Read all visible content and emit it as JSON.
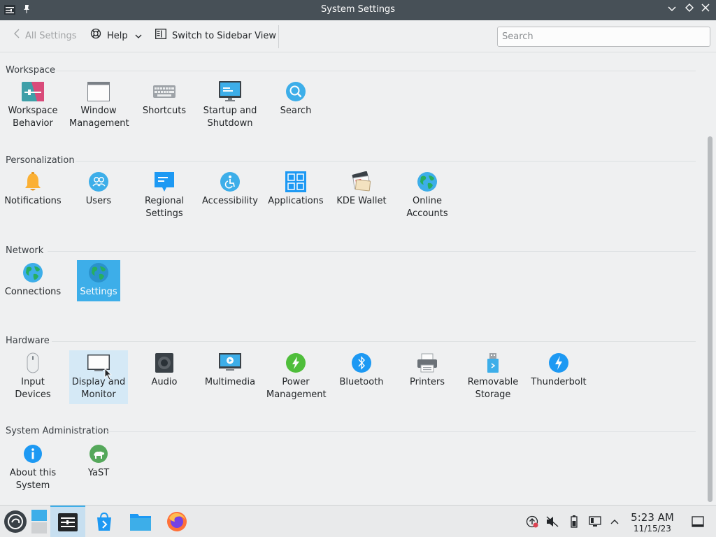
{
  "window": {
    "title": "System Settings",
    "pin_icon": "pin-icon",
    "buttons": [
      "minimize-icon",
      "maximize-icon",
      "close-icon"
    ]
  },
  "toolbar": {
    "back_label": "All Settings",
    "help_label": "Help",
    "switch_label": "Switch to Sidebar View",
    "search_placeholder": "Search"
  },
  "sections": [
    {
      "title": "Workspace",
      "items": [
        {
          "label": "Workspace Behavior",
          "icon": "workspace-behavior-icon"
        },
        {
          "label": "Window Management",
          "icon": "window-management-icon"
        },
        {
          "label": "Shortcuts",
          "icon": "keyboard-icon"
        },
        {
          "label": "Startup and Shutdown",
          "icon": "monitor-icon"
        },
        {
          "label": "Search",
          "icon": "search-icon"
        }
      ]
    },
    {
      "title": "Personalization",
      "items": [
        {
          "label": "Notifications",
          "icon": "bell-icon"
        },
        {
          "label": "Users",
          "icon": "users-icon"
        },
        {
          "label": "Regional Settings",
          "icon": "speech-bubble-icon"
        },
        {
          "label": "Accessibility",
          "icon": "accessibility-icon"
        },
        {
          "label": "Applications",
          "icon": "applications-grid-icon"
        },
        {
          "label": "KDE Wallet",
          "icon": "wallet-icon"
        },
        {
          "label": "Online Accounts",
          "icon": "globe-icon"
        }
      ]
    },
    {
      "title": "Network",
      "items": [
        {
          "label": "Connections",
          "icon": "globe-icon"
        },
        {
          "label": "Settings",
          "icon": "globe-icon",
          "state": "selected"
        }
      ]
    },
    {
      "title": "Hardware",
      "items": [
        {
          "label": "Input Devices",
          "icon": "mouse-icon"
        },
        {
          "label": "Display and Monitor",
          "icon": "display-icon",
          "state": "hover"
        },
        {
          "label": "Audio",
          "icon": "speaker-icon"
        },
        {
          "label": "Multimedia",
          "icon": "multimedia-icon"
        },
        {
          "label": "Power Management",
          "icon": "power-icon"
        },
        {
          "label": "Bluetooth",
          "icon": "bluetooth-icon"
        },
        {
          "label": "Printers",
          "icon": "printer-icon"
        },
        {
          "label": "Removable Storage",
          "icon": "usb-drive-icon"
        },
        {
          "label": "Thunderbolt",
          "icon": "thunderbolt-icon"
        }
      ]
    },
    {
      "title": "System Administration",
      "items": [
        {
          "label": "About this System",
          "icon": "info-icon"
        },
        {
          "label": "YaST",
          "icon": "yast-icon"
        }
      ]
    }
  ],
  "taskbar": {
    "items": [
      "opensuse-menu-icon",
      "pager-icon",
      "system-settings-icon",
      "discover-icon",
      "file-manager-icon",
      "firefox-icon"
    ],
    "tray": [
      "updates-icon",
      "volume-muted-icon",
      "battery-icon",
      "network-icon",
      "tray-expand-icon"
    ],
    "time": "5:23 AM",
    "date": "11/15/23",
    "show_desktop": "show-desktop-icon"
  },
  "colors": {
    "accent": "#3daee9",
    "titlebar": "#475057",
    "background": "#eff0f1"
  }
}
